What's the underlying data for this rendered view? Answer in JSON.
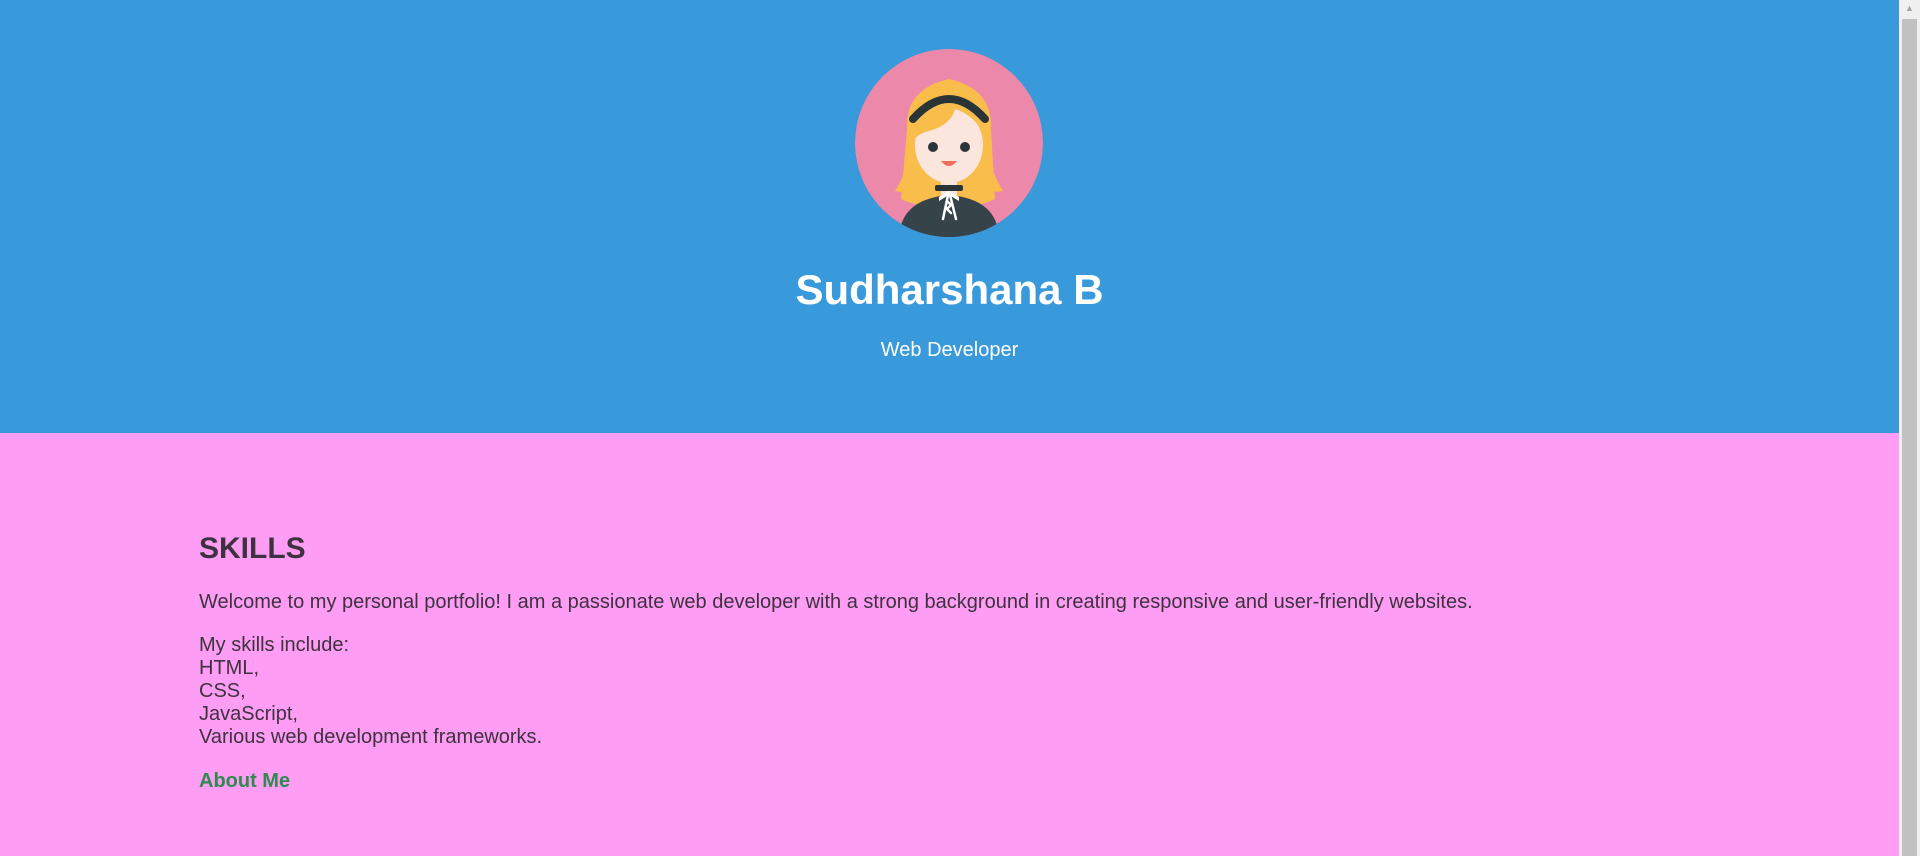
{
  "header": {
    "name": "Sudharshana B",
    "role": "Web Developer",
    "avatar_icon": "girl-avatar-icon",
    "background_color": "#3899db"
  },
  "main": {
    "background_color": "#ff9cf3",
    "heading": "SKILLS",
    "intro": "Welcome to my personal portfolio! I am a passionate web developer with a strong background in creating responsive and user-friendly websites.",
    "skills_lead": "My skills include:",
    "skills": [
      "HTML,",
      "CSS,",
      "JavaScript,",
      "Various web development frameworks."
    ],
    "about_link": "About Me",
    "link_color": "#2e8a4f"
  },
  "scrollbar": {
    "up_icon": "scroll-up-arrow-icon"
  }
}
